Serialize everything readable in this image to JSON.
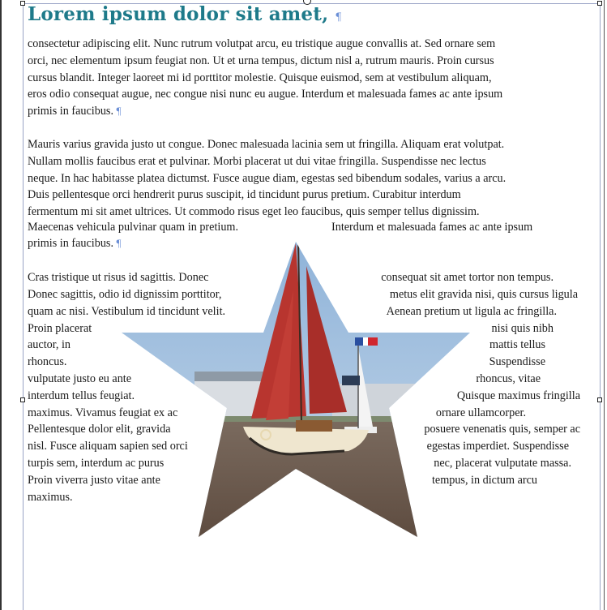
{
  "document": {
    "heading": "Lorem ipsum dolor sit amet,",
    "pilcrow": "¶",
    "paragraph1": [
      "consectetur adipiscing elit. Nunc rutrum volutpat arcu, eu tristique augue convallis at. Sed ornare sem",
      "orci, nec elementum ipsum feugiat non. Ut et urna tempus, dictum nisl a, rutrum mauris. Proin cursus",
      "cursus blandit. Integer laoreet mi id porttitor molestie. Quisque euismod, sem at vestibulum aliquam,",
      "eros odio consequat augue, nec congue nisi nunc eu augue. Interdum et malesuada fames ac ante ipsum",
      "primis in faucibus."
    ],
    "paragraph2": [
      "Mauris varius gravida justo ut congue. Donec malesuada lacinia sem ut fringilla. Aliquam erat volutpat.",
      "Nullam mollis faucibus erat et pulvinar. Morbi placerat ut dui vitae fringilla. Suspendisse nec lectus",
      "neque. In hac habitasse platea dictumst. Fusce augue diam, egestas sed bibendum sodales, varius a arcu.",
      "Duis pellentesque orci hendrerit purus suscipit, id tincidunt purus pretium. Curabitur interdum",
      "fermentum mi sit amet ultrices. Ut commodo risus eget leo faucibus, quis semper tellus dignissim."
    ],
    "paragraph2_split": {
      "left": "Maecenas vehicula pulvinar quam in pretium.",
      "right": "Interdum et malesuada fames ac ante ipsum"
    },
    "paragraph2_last": "primis in faucibus.",
    "paragraph3_left": [
      "Cras tristique ut risus id sagittis. Donec",
      "Donec sagittis, odio id dignissim porttitor,",
      "quam ac nisi. Vestibulum id tincidunt velit.",
      "Proin placerat",
      "auctor, in",
      "rhoncus.",
      "vulputate justo eu ante",
      "interdum tellus feugiat.",
      "maximus. Vivamus feugiat ex ac",
      "Pellentesque dolor elit, gravida",
      "nisl. Fusce aliquam sapien sed orci",
      "turpis sem, interdum ac purus",
      "Proin viverra justo vitae ante",
      "maximus."
    ],
    "paragraph3_right": [
      "consequat sit amet tortor non tempus.",
      "metus elit gravida nisi, quis cursus ligula",
      "Aenean pretium ut ligula ac fringilla.",
      "nisi quis nibh",
      "mattis tellus",
      "Suspendisse",
      "rhoncus, vitae",
      "Quisque maximus fringilla",
      "ornare ullamcorper.",
      "posuere venenatis quis, semper ac",
      "egestas imperdiet. Suspendisse",
      "nec, placerat vulputate massa.",
      "tempus, in dictum arcu",
      ""
    ]
  },
  "image": {
    "description_icon": "star-shaped-sailboat-photo",
    "sail_color": "#b8352f",
    "sky_color": "#a8c6e6",
    "water_color": "#6b5a4e"
  },
  "colors": {
    "heading": "#1e7a8a",
    "formatting_marks": "#6b8fd6",
    "spellcheck": "#d33",
    "frame": "#9aa4c6"
  }
}
